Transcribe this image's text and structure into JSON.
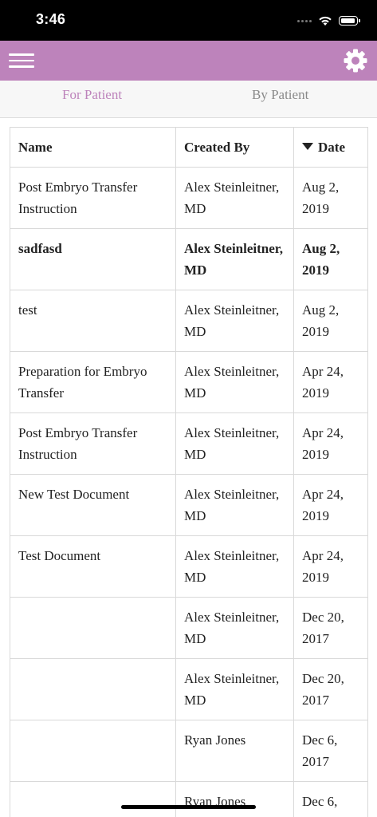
{
  "status_bar": {
    "time": "3:46"
  },
  "icons": {
    "menu": "hamburger-menu-icon",
    "settings": "gear-icon",
    "sort": "sort-descending-icon",
    "wifi": "wifi-icon",
    "battery": "battery-icon"
  },
  "colors": {
    "brand": "#bd83bb",
    "tab_active": "#bd83bb",
    "tab_inactive": "#8a8a8a"
  },
  "tabs": [
    {
      "label": "For Patient",
      "active": true
    },
    {
      "label": "By Patient",
      "active": false
    }
  ],
  "table": {
    "headers": {
      "name": "Name",
      "created_by": "Created By",
      "date": "Date"
    },
    "sort_column": "date",
    "sort_direction": "descending",
    "rows": [
      {
        "name": "Post Embryo Transfer Instruction",
        "created_by": "Alex Steinleitner, MD",
        "date": "Aug 2, 2019",
        "bold": false
      },
      {
        "name": "sadfasd",
        "created_by": "Alex Steinleitner, MD",
        "date": "Aug 2, 2019",
        "bold": true
      },
      {
        "name": "test",
        "created_by": "Alex Steinleitner, MD",
        "date": "Aug 2, 2019",
        "bold": false
      },
      {
        "name": "Preparation for Embryo Transfer",
        "created_by": "Alex Steinleitner, MD",
        "date": "Apr 24, 2019",
        "bold": false
      },
      {
        "name": "Post Embryo Transfer Instruction",
        "created_by": "Alex Steinleitner, MD",
        "date": "Apr 24, 2019",
        "bold": false
      },
      {
        "name": "New Test Document",
        "created_by": "Alex Steinleitner, MD",
        "date": "Apr 24, 2019",
        "bold": false
      },
      {
        "name": "Test Document",
        "created_by": "Alex Steinleitner, MD",
        "date": "Apr 24, 2019",
        "bold": false
      },
      {
        "name": "",
        "created_by": "Alex Steinleitner, MD",
        "date": "Dec 20, 2017",
        "bold": false
      },
      {
        "name": "",
        "created_by": "Alex Steinleitner, MD",
        "date": "Dec 20, 2017",
        "bold": false
      },
      {
        "name": "",
        "created_by": "Ryan Jones",
        "date": "Dec 6, 2017",
        "bold": false
      },
      {
        "name": "",
        "created_by": "Ryan Jones",
        "date": "Dec 6,",
        "bold": false
      }
    ]
  }
}
